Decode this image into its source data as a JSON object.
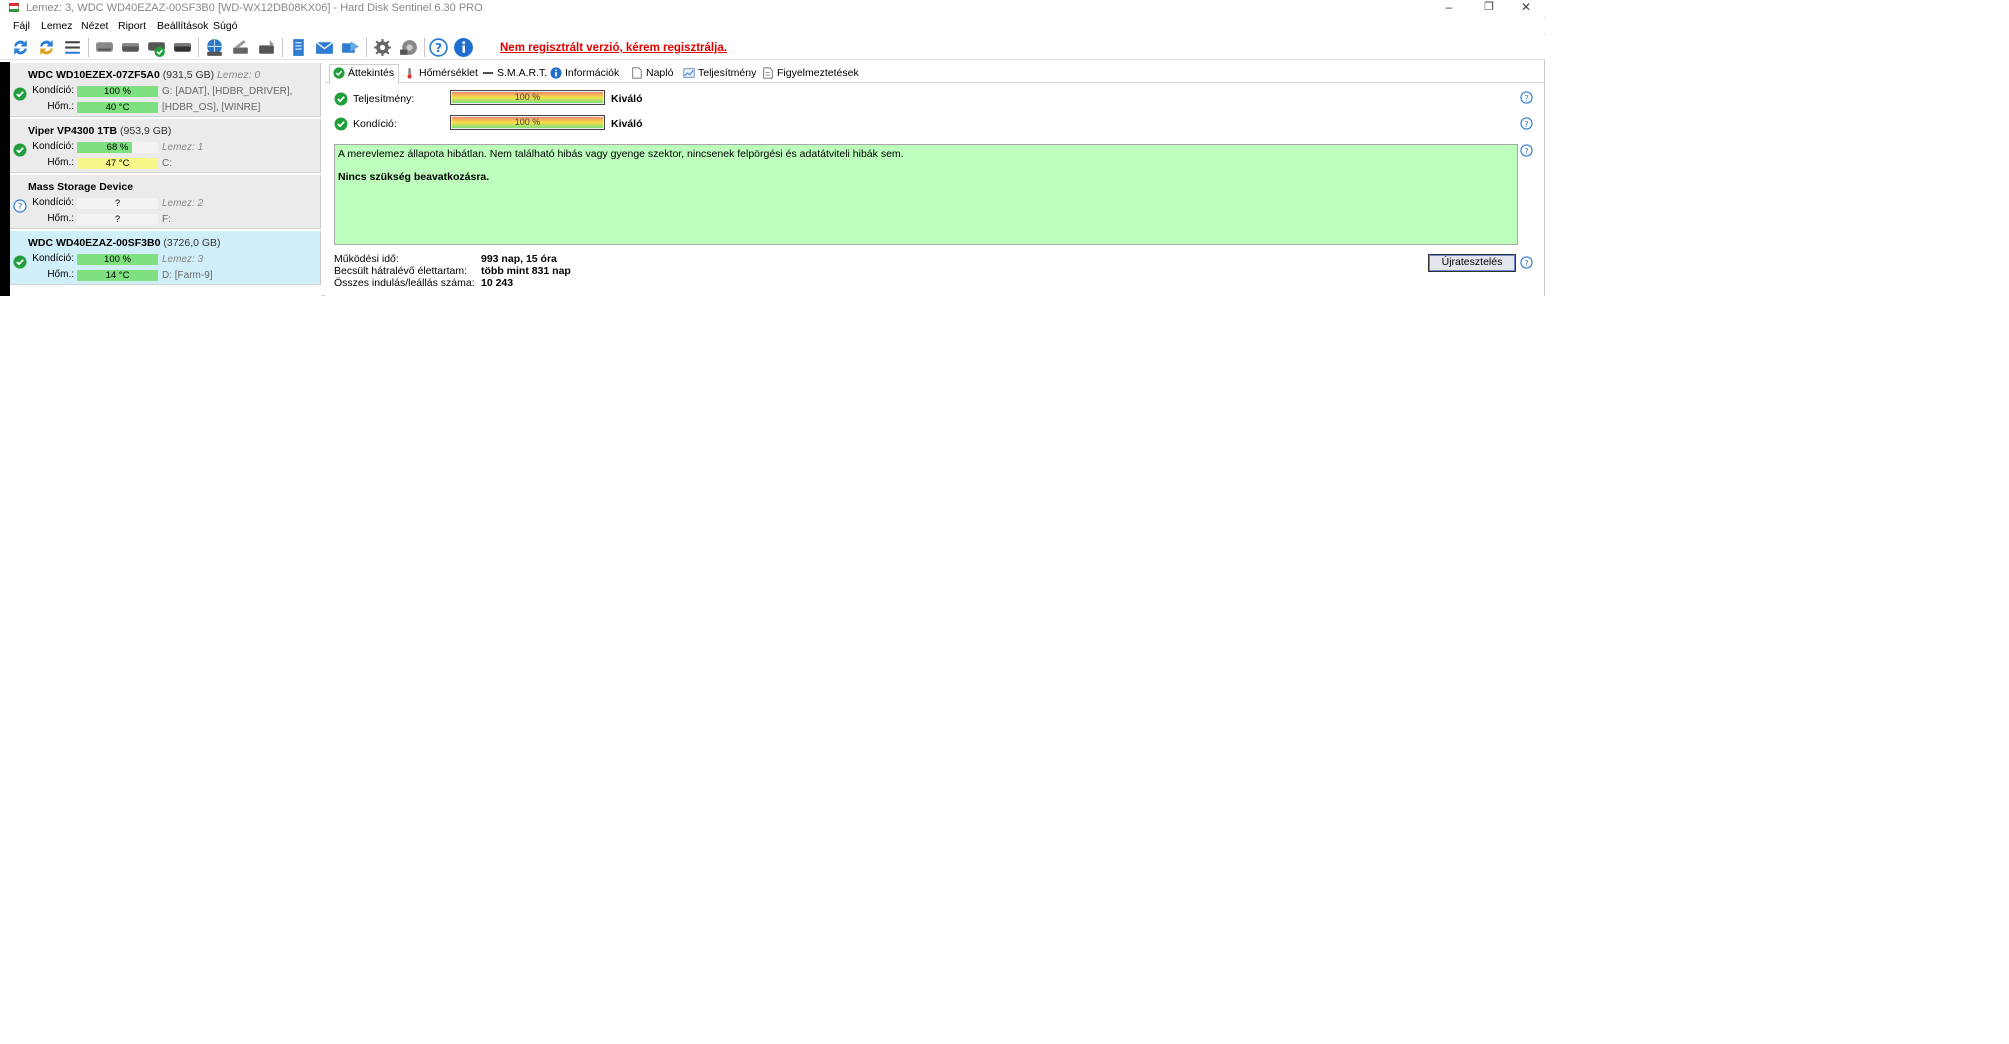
{
  "window": {
    "title": "Lemez: 3, WDC WD40EZAZ-00SF3B0 [WD-WX12DB08KX06]  -  Hard Disk Sentinel 6.30 PRO",
    "minimize": "–",
    "restore": "❐",
    "close": "✕"
  },
  "menu": [
    "Fájl",
    "Lemez",
    "Nézet",
    "Riport",
    "Beállítások",
    "Súgó"
  ],
  "toolbar": {
    "icons": [
      "refresh-icon",
      "refresh-all-icon",
      "list-icon",
      "disk-gray-icon",
      "disk-check-icon",
      "disk-green-icon",
      "disk-dark-icon",
      "globe-disk-icon",
      "tools-icon",
      "drive-icon",
      "notepad-icon",
      "mail-icon",
      "send-icon",
      "gear-icon",
      "settings-icon",
      "help-icon",
      "info-icon"
    ],
    "unregistered": "Nem regisztrált verzió, kérem regisztrálja."
  },
  "disks": [
    {
      "name": "WDC WD10EZEX-07ZF5A0",
      "size": "(931,5 GB)",
      "lemez": "Lemez: 0",
      "status": "ok",
      "kondicio_label": "Kondíció:",
      "kondicio": "100 %",
      "kondicio_level": 100,
      "kondicio_color": "#7ee07e",
      "hom_label": "Hőm.:",
      "hom": "40 °C",
      "hom_color": "#7ee07e",
      "info1": "G: [ADAT],  [HDBR_DRIVER],",
      "info2": "[HDBR_OS],  [WINRE]",
      "info1_italic": false
    },
    {
      "name": "Viper VP4300 1TB",
      "size": "(953,9 GB)",
      "lemez": "",
      "status": "ok",
      "kondicio_label": "Kondíció:",
      "kondicio": "68 %",
      "kondicio_level": 68,
      "kondicio_color": "#7ee07e",
      "hom_label": "Hőm.:",
      "hom": "47 °C",
      "hom_color": "#f6f68a",
      "info1": "Lemez: 1",
      "info2": "C:",
      "info1_italic": true
    },
    {
      "name": "Mass    Storage Device",
      "size": "",
      "lemez": "",
      "status": "unknown",
      "kondicio_label": "Kondíció:",
      "kondicio": "?",
      "kondicio_level": 0,
      "kondicio_color": "#f3f3f3",
      "hom_label": "Hőm.:",
      "hom": "?",
      "hom_color": "#f3f3f3",
      "info1": "Lemez: 2",
      "info2": "F:",
      "info1_italic": true
    },
    {
      "name": "WDC WD40EZAZ-00SF3B0",
      "size": "(3726,0 GB)",
      "lemez": "",
      "status": "ok",
      "kondicio_label": "Kondíció:",
      "kondicio": "100 %",
      "kondicio_level": 100,
      "kondicio_color": "#7ee07e",
      "hom_label": "Hőm.:",
      "hom": "14 °C",
      "hom_color": "#7ee07e",
      "info1": "Lemez: 3",
      "info2": "D: [Farm-9]",
      "info1_italic": true
    }
  ],
  "tabs": [
    {
      "label": "Áttekintés",
      "icon": "check-icon"
    },
    {
      "label": "Hőmérséklet",
      "icon": "thermometer-icon"
    },
    {
      "label": "S.M.A.R.T.",
      "icon": "smart-icon"
    },
    {
      "label": "Információk",
      "icon": "info-icon"
    },
    {
      "label": "Napló",
      "icon": "log-icon"
    },
    {
      "label": "Teljesítmény",
      "icon": "performance-icon"
    },
    {
      "label": "Figyelmeztetések",
      "icon": "alerts-icon"
    }
  ],
  "overview": {
    "performance_label": "Teljesítmény:",
    "performance_value": "100 %",
    "performance_level": 100,
    "performance_rating": "Kiváló",
    "condition_label": "Kondíció:",
    "condition_value": "100 %",
    "condition_level": 100,
    "condition_rating": "Kiváló",
    "message_line1": "A merevlemez állapota hibátlan. Nem található hibás vagy gyenge szektor, nincsenek felpörgési és adatátviteli hibák sem.",
    "message_line2": "Nincs szükség beavatkozásra.",
    "uptime_label": "Működési idő:",
    "uptime_value": "993 nap, 15 óra",
    "lifetime_label": "Becsült hátralévő élettartam:",
    "lifetime_value": "több mint 831 nap",
    "startstop_label": "Összes indulás/leállás száma:",
    "startstop_value": "10 243",
    "retest_button": "Újratesztelés"
  }
}
